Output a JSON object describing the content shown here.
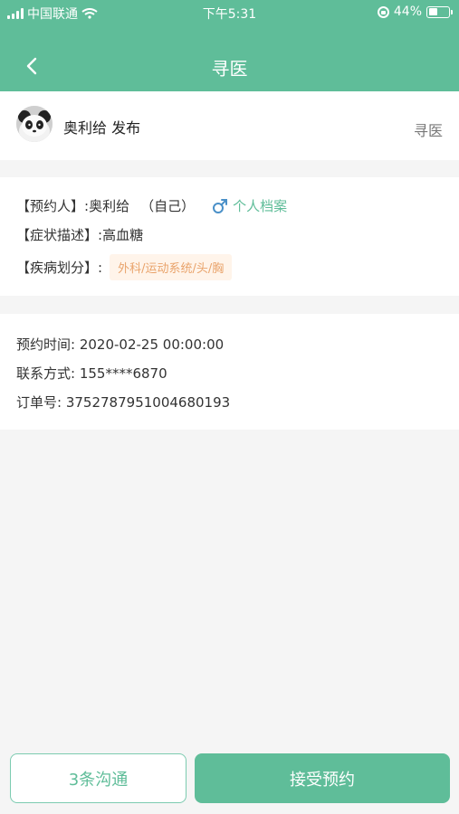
{
  "status_bar": {
    "carrier": "中国联通",
    "time": "下午5:31",
    "battery": "44%"
  },
  "nav": {
    "title": "寻医"
  },
  "post": {
    "user_line": "奥利给 发布",
    "type": "寻医"
  },
  "patient": {
    "label_booker": "【预约人】:",
    "booker_name": "奥利给",
    "self_tag": "（自己）",
    "profile_link": "个人档案",
    "label_symptom": "【症状描述】:",
    "symptom": "高血糖",
    "label_category": "【疾病划分】:",
    "category": "外科/运动系统/头/胸"
  },
  "order": {
    "time_label": "预约时间:",
    "time_value": "2020-02-25 00:00:00",
    "contact_label": "联系方式:",
    "contact_value": "155****6870",
    "order_label": "订单号:",
    "order_value": "3752787951004680193"
  },
  "actions": {
    "chat_label": "3条沟通",
    "accept_label": "接受预约"
  },
  "colors": {
    "brand": "#5fbd99",
    "tag_bg": "#fff4ea",
    "tag_text": "#e9a36b"
  }
}
